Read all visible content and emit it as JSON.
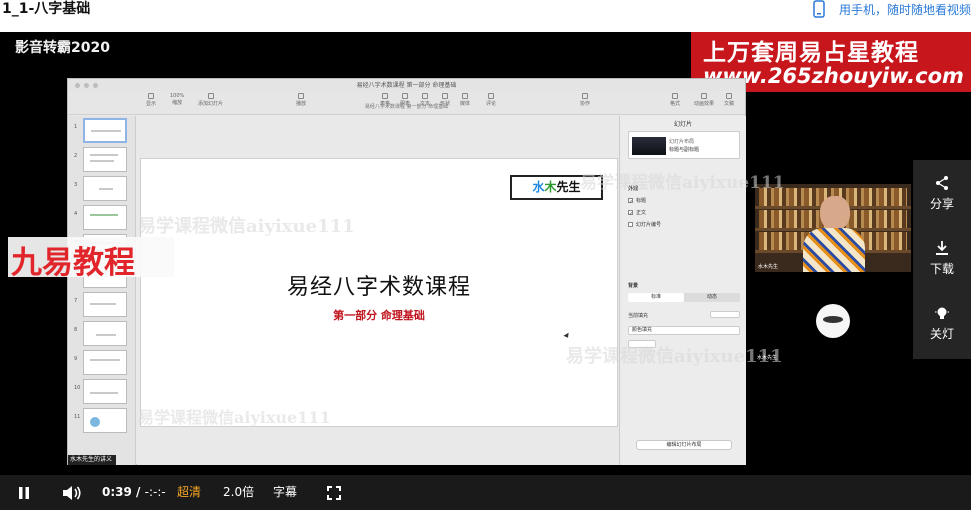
{
  "page": {
    "title": "1_1-八字基础",
    "mobile_link": "用手机，随时随地看视频"
  },
  "video": {
    "watermark_channel": "影音转霸2020",
    "banner_line1": "上万套周易占星教程",
    "banner_line2": "www.265zhouyiw.com",
    "jiuyi": "九易教程",
    "overlay_watermark": "易学课程微信aiyixue111",
    "keynote": {
      "doc_title": "易经八字术数课程 第一部分 命理基础",
      "doc_subtitle": "易经八字术数课程 第一部分 命理基础",
      "toolbar": [
        "显示",
        "缩放",
        "添加幻灯片",
        "播放",
        "表格",
        "图表",
        "文本",
        "形状",
        "媒体",
        "评论",
        "协作",
        "格式",
        "动画效果",
        "文稿"
      ],
      "zoom": "100%",
      "thumb_numbers": [
        "1",
        "2",
        "3",
        "4",
        "5",
        "6",
        "7",
        "8",
        "9",
        "10",
        "11"
      ],
      "thumbs_caption": "水木先生的讲义截图",
      "slide": {
        "logo_water": "水",
        "logo_wood": "木",
        "logo_rest": "先生",
        "title": "易经八字术数课程",
        "subtitle": "第一部分  命理基础"
      },
      "inspector": {
        "tab": "幻灯片",
        "layout_name": "幻灯片布局",
        "layout_value": "标题与副标题",
        "appearance_header": "外观",
        "check_title": "标题",
        "check_body": "正文",
        "check_slide_number": "幻灯片编号",
        "background_header": "背景",
        "seg_standard": "标准",
        "seg_dynamic": "动态",
        "current_fill": "当前填充",
        "fill_select": "颜色填充",
        "edit_layout": "编辑幻灯片布局"
      }
    },
    "webcam_label": "水木先生",
    "avatar_name": "水木先生"
  },
  "side_panel": {
    "share": "分享",
    "download": "下载",
    "lights_off": "关灯"
  },
  "controls": {
    "time_current": "0:39",
    "time_sep": "/",
    "time_total": "-:-:-",
    "quality": "超清",
    "speed": "2.0倍",
    "subtitle": "字幕"
  }
}
